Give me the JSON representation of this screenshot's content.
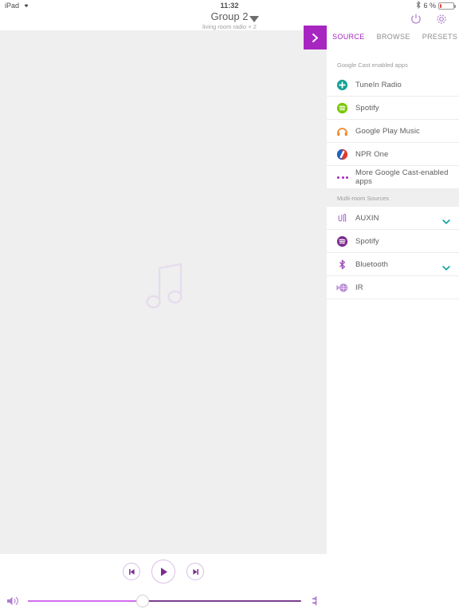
{
  "statusbar": {
    "device": "iPad",
    "wifi_icon": "wifi-icon",
    "time": "11:32",
    "bluetooth_icon": "bluetooth-icon",
    "battery_percent": "6 %",
    "battery_level": 6,
    "battery_color": "#e8453c"
  },
  "navbar": {
    "title": "Group 2",
    "subtitle": "living room radio + 2",
    "caret_icon": "caret-down-icon",
    "power_icon": "power-icon",
    "settings_icon": "gear-icon",
    "icon_color": "#b07fd0"
  },
  "player": {
    "artwork_placeholder_icon": "music-note-icon",
    "background": "#efefef"
  },
  "source_panel": {
    "expand_button": {
      "icon": "chevron-right-icon",
      "color": "#a726c1"
    },
    "tabs": [
      {
        "label": "SOURCE",
        "active": true
      },
      {
        "label": "BROWSE",
        "active": false
      },
      {
        "label": "PRESETS",
        "active": false
      }
    ],
    "active_color": "#a726c1",
    "sections": [
      {
        "heading": "Google Cast enabled apps",
        "items": [
          {
            "label": "TuneIn Radio",
            "icon": "tunein-icon",
            "icon_color": "#17a398",
            "chevron": false
          },
          {
            "label": "Spotify",
            "icon": "spotify-icon",
            "icon_color": "#78c800",
            "chevron": false
          },
          {
            "label": "Google Play Music",
            "icon": "headphones-icon",
            "icon_color": "#f2892b",
            "chevron": false
          },
          {
            "label": "NPR One",
            "icon": "npr-one-icon",
            "icon_color": "#e03a2f",
            "chevron": false
          },
          {
            "label": "More Google Cast-enabled apps",
            "icon": "more-dots-icon",
            "icon_color": "#a726c1",
            "chevron": false
          }
        ]
      },
      {
        "heading": "Multi-room Sources",
        "items": [
          {
            "label": "AUXIN",
            "icon": "aux-in-icon",
            "icon_color": "#b07fd0",
            "chevron": true
          },
          {
            "label": "Spotify",
            "icon": "spotify-icon",
            "icon_color": "#7b2d8e",
            "chevron": false
          },
          {
            "label": "Bluetooth",
            "icon": "bluetooth-icon",
            "icon_color": "#9a4fb5",
            "chevron": false
          },
          {
            "label": "IR",
            "icon": "ir-icon",
            "icon_color": "#b07fd0",
            "chevron": false
          }
        ]
      }
    ],
    "chevron_color": "#12a0a0"
  },
  "transport": {
    "previous_label": "previous-track",
    "play_label": "play",
    "next_label": "next-track",
    "accent": "#7b2d8e"
  },
  "volume": {
    "mute_icon": "speaker-low-icon",
    "max_icon": "speaker-high-icon",
    "level_percent": 42,
    "fill_color": "#d46ef0",
    "track_color": "#7a3e8f"
  }
}
